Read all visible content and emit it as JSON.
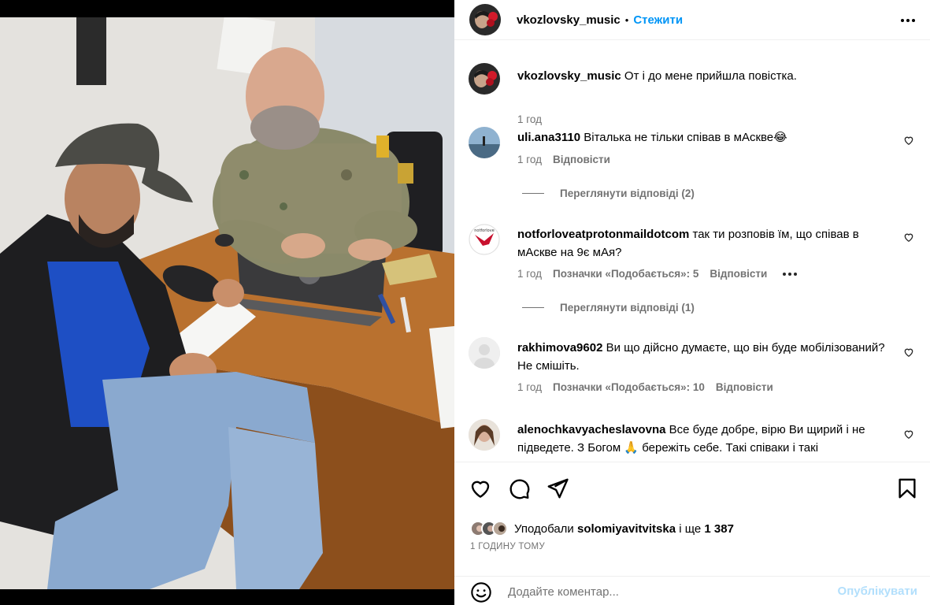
{
  "post": {
    "author": "vkozlovsky_music",
    "separator": "•",
    "follow_label": "Стежити",
    "caption_user": "vkozlovsky_music",
    "caption_text": "От і до мене прийшла повістка.",
    "caption_time": "1 год"
  },
  "comments": [
    {
      "user": "uli.ana3110",
      "text": "Віталька не тільки співав в мАскве😂",
      "time": "1 год",
      "likes": "",
      "reply": "Відповісти",
      "view_replies": "Переглянути відповіді (2)"
    },
    {
      "user": "notforloveatprotonmaildotcom",
      "text": "так ти розповів їм, що співав в мАскве на 9є мАя?",
      "time": "1 год",
      "likes": "Позначки «Подобається»: 5",
      "reply": "Відповісти",
      "view_replies": "Переглянути відповіді (1)"
    },
    {
      "user": "rakhimova9602",
      "text": "Ви що дійсно думаєте, що він буде мобілізований?Не смішіть.",
      "time": "1 год",
      "likes": "Позначки «Подобається»: 10",
      "reply": "Відповісти"
    },
    {
      "user": "alenochkavyacheslavovna",
      "text": "Все буде добре, вірю Ви щирий і не підведете. З Богом 🙏 бережіть себе. Такі співаки і такі"
    }
  ],
  "likes": {
    "prefix": "Уподобали",
    "user": "solomiyavitvitska",
    "middle": "і ще",
    "count": "1 387"
  },
  "time_ago": "1 ГОДИНУ ТОМУ",
  "add_comment": {
    "placeholder": "Додайте коментар...",
    "publish_label": "Опублікувати"
  },
  "icons": {
    "like": "heart-icon",
    "comment": "comment-bubble-icon",
    "share": "paper-plane-icon",
    "save": "bookmark-icon",
    "emoji": "smiley-icon",
    "more": "ellipsis-icon"
  },
  "colors": {
    "follow": "#0095f6",
    "publish_disabled": "#b2dffc",
    "meta": "#737373"
  }
}
